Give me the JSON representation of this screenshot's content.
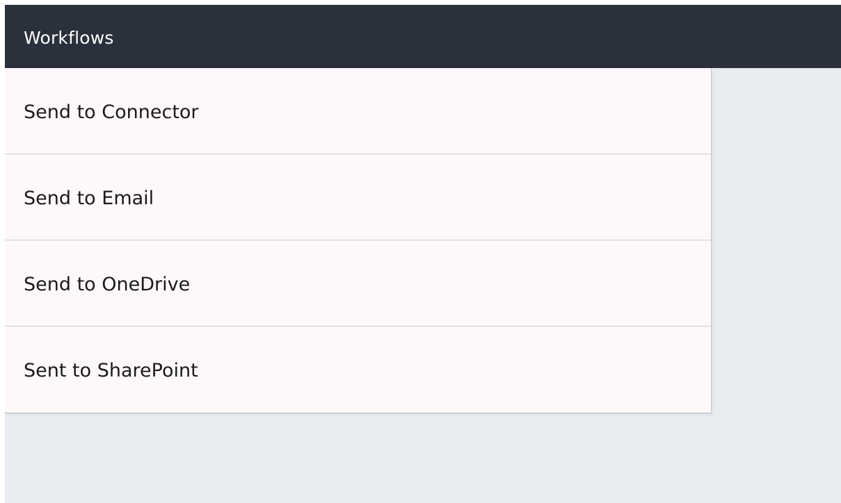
{
  "header": {
    "title": "Workflows"
  },
  "workflows": {
    "items": [
      {
        "label": "Send to Connector"
      },
      {
        "label": "Send to Email"
      },
      {
        "label": "Send to OneDrive"
      },
      {
        "label": "Sent to SharePoint"
      }
    ]
  },
  "colors": {
    "title_bar": "#2a313c",
    "list_background": "#fef8fa",
    "screen_background": "#e9edf2",
    "text": "#1a1a1a"
  }
}
